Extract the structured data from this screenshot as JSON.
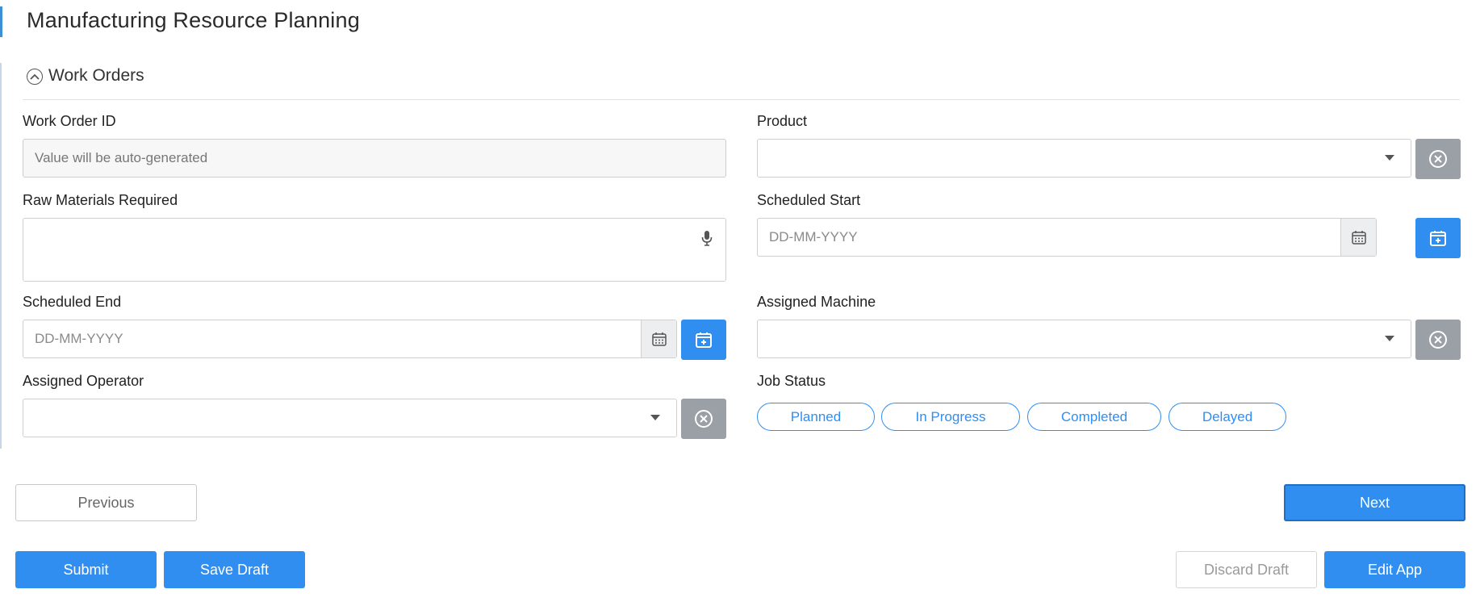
{
  "page": {
    "title": "Manufacturing Resource Planning"
  },
  "section": {
    "title": "Work Orders"
  },
  "fields": {
    "work_order_id": {
      "label": "Work Order ID",
      "placeholder": "Value will be auto-generated"
    },
    "product": {
      "label": "Product",
      "value": ""
    },
    "raw_materials": {
      "label": "Raw Materials Required",
      "value": ""
    },
    "scheduled_start": {
      "label": "Scheduled Start",
      "placeholder": "DD-MM-YYYY"
    },
    "scheduled_end": {
      "label": "Scheduled End",
      "placeholder": "DD-MM-YYYY"
    },
    "assigned_machine": {
      "label": "Assigned Machine",
      "value": ""
    },
    "assigned_operator": {
      "label": "Assigned Operator",
      "value": ""
    },
    "job_status": {
      "label": "Job Status",
      "options": [
        "Planned",
        "In Progress",
        "Completed",
        "Delayed"
      ]
    }
  },
  "navigation": {
    "previous_label": "Previous",
    "next_label": "Next"
  },
  "actions": {
    "submit_label": "Submit",
    "save_draft_label": "Save Draft",
    "discard_draft_label": "Discard Draft",
    "edit_app_label": "Edit App"
  },
  "colors": {
    "accent": "#2f8ef0",
    "clear_button": "#9aa0a6",
    "title_accent": "#3d8fd6"
  },
  "icons": {
    "section_toggle": "chevron-up-circle-icon",
    "mic": "microphone-icon",
    "clear": "close-circle-icon",
    "calendar": "calendar-icon",
    "calendar_add": "calendar-plus-icon",
    "dropdown": "caret-down-icon"
  }
}
